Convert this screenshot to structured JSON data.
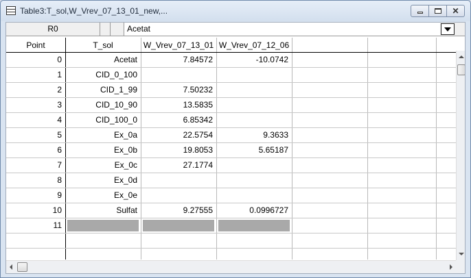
{
  "window": {
    "title": "Table3:T_sol,W_Vrev_07_13_01_new,..."
  },
  "entry_line": {
    "row_ref": "R0",
    "value": "Acetat"
  },
  "table": {
    "columns": [
      "Point",
      "T_sol",
      "W_Vrev_07_13_01",
      "W_Vrev_07_12_06",
      "",
      "",
      ""
    ],
    "rows": [
      [
        "0",
        "Acetat",
        "7.84572",
        "-10.0742"
      ],
      [
        "1",
        "CID_0_100",
        "",
        ""
      ],
      [
        "2",
        "CID_1_99",
        "7.50232",
        ""
      ],
      [
        "3",
        "CID_10_90",
        "13.5835",
        ""
      ],
      [
        "4",
        "CID_100_0",
        "6.85342",
        ""
      ],
      [
        "5",
        "Ex_0a",
        "22.5754",
        "9.3633"
      ],
      [
        "6",
        "Ex_0b",
        "19.8053",
        "5.65187"
      ],
      [
        "7",
        "Ex_0c",
        "27.1774",
        ""
      ],
      [
        "8",
        "Ex_0d",
        "",
        ""
      ],
      [
        "9",
        "Ex_0e",
        "",
        ""
      ],
      [
        "10",
        "Sulfat",
        "9.27555",
        "0.0996727"
      ]
    ],
    "insertion_row": "11"
  }
}
